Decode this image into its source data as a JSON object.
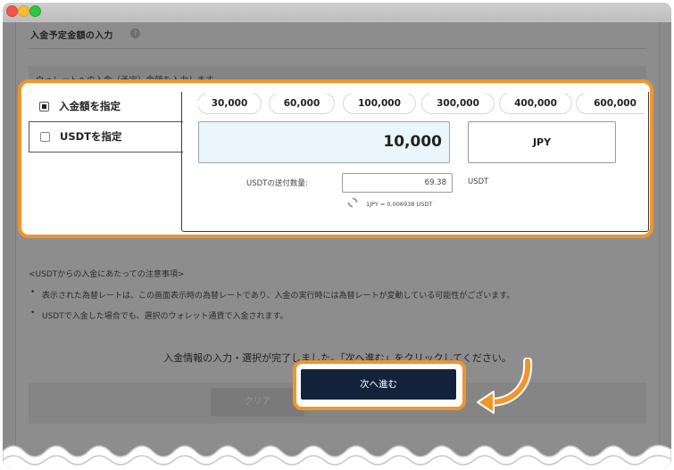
{
  "section": {
    "title": "入金予定金額の入力",
    "instruction": "ウォレットへの入金（予定）金額を入力します。"
  },
  "tabs": [
    {
      "label": "入金額を指定",
      "checked": true
    },
    {
      "label": "USDTを指定",
      "checked": false
    }
  ],
  "presets": [
    "30,000",
    "60,000",
    "100,000",
    "300,000",
    "400,000",
    "600,000"
  ],
  "amount": {
    "value": "10,000",
    "currency": "JPY"
  },
  "usdt": {
    "label": "USDTの送付数量:",
    "value": "69.38",
    "unit": "USDT",
    "rate": "1JPY = 0.006938 USDT"
  },
  "notes": {
    "heading": "<USDTからの入金にあたっての注意事項>",
    "items": [
      "表示された為替レートは、この画面表示時の為替レートであり、入金の実行時には為替レートが変動している可能性がございます。",
      "USDTで入金した場合でも、選択のウォレット通貨で入金されます。"
    ],
    "bullet": "•"
  },
  "complete_message": "入金情報の入力・選択が完了しました。「次へ進む」をクリックしてください。",
  "buttons": {
    "clear": "クリア",
    "next": "次へ進む"
  },
  "colors": {
    "highlight": "#f0952a",
    "next_button": "#12223a",
    "amount_field": "#eaf5fc"
  }
}
